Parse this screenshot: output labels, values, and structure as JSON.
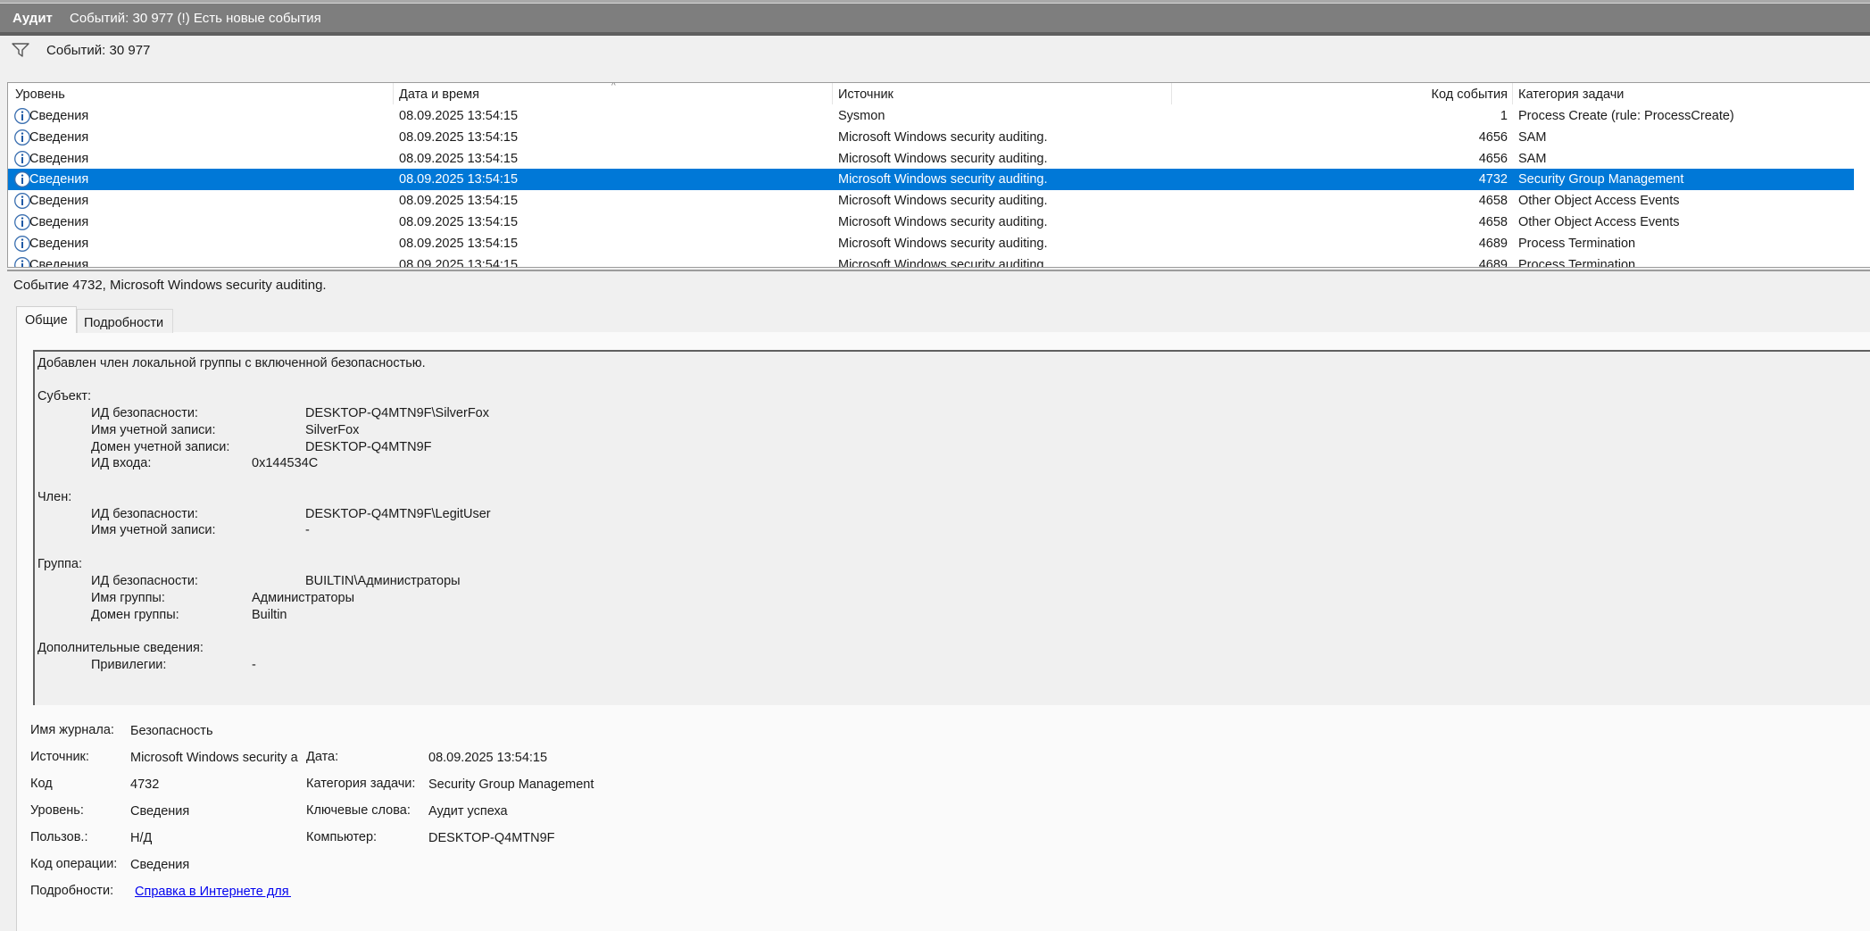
{
  "header": {
    "title": "Аудит",
    "count_text": "Событий: 30 977 (!) Есть новые события"
  },
  "filter": {
    "count_text": "Событий: 30 977"
  },
  "table": {
    "columns": [
      "Уровень",
      "Дата и время",
      "Источник",
      "Код события",
      "Категория задачи"
    ],
    "selected_row": 3,
    "rows": [
      {
        "level": "Сведения",
        "datetime": "08.09.2025 13:54:15",
        "source": "Sysmon",
        "code": "1",
        "category": "Process Create (rule: ProcessCreate)"
      },
      {
        "level": "Сведения",
        "datetime": "08.09.2025 13:54:15",
        "source": "Microsoft Windows security auditing.",
        "code": "4656",
        "category": "SAM"
      },
      {
        "level": "Сведения",
        "datetime": "08.09.2025 13:54:15",
        "source": "Microsoft Windows security auditing.",
        "code": "4656",
        "category": "SAM"
      },
      {
        "level": "Сведения",
        "datetime": "08.09.2025 13:54:15",
        "source": "Microsoft Windows security auditing.",
        "code": "4732",
        "category": "Security Group Management"
      },
      {
        "level": "Сведения",
        "datetime": "08.09.2025 13:54:15",
        "source": "Microsoft Windows security auditing.",
        "code": "4658",
        "category": "Other Object Access Events"
      },
      {
        "level": "Сведения",
        "datetime": "08.09.2025 13:54:15",
        "source": "Microsoft Windows security auditing.",
        "code": "4658",
        "category": "Other Object Access Events"
      },
      {
        "level": "Сведения",
        "datetime": "08.09.2025 13:54:15",
        "source": "Microsoft Windows security auditing.",
        "code": "4689",
        "category": "Process Termination"
      },
      {
        "level": "Сведения",
        "datetime": "08.09.2025 13:54:15",
        "source": "Microsoft Windows security auditing.",
        "code": "4689",
        "category": "Process Termination"
      }
    ]
  },
  "detail": {
    "title": "Событие 4732, Microsoft Windows security auditing.",
    "tabs": [
      "Общие",
      "Подробности"
    ],
    "message": {
      "intro": "Добавлен член локальной группы с включенной безопасностью.",
      "subject_header": "Субъект:",
      "subject": [
        {
          "label": "ИД безопасности:",
          "value": "DESKTOP-Q4MTN9F\\SilverFox"
        },
        {
          "label": "Имя учетной записи:",
          "value": "SilverFox"
        },
        {
          "label": "Домен учетной записи:",
          "value": "DESKTOP-Q4MTN9F"
        },
        {
          "label": "ИД входа:",
          "value": "0x144534C"
        }
      ],
      "member_header": "Член:",
      "member": [
        {
          "label": "ИД безопасности:",
          "value": "DESKTOP-Q4MTN9F\\LegitUser"
        },
        {
          "label": "Имя учетной записи:",
          "value": "-"
        }
      ],
      "group_header": "Группа:",
      "group": [
        {
          "label": "ИД безопасности:",
          "value": "BUILTIN\\Администраторы"
        },
        {
          "label": "Имя группы:",
          "value": "Администраторы"
        },
        {
          "label": "Домен группы:",
          "value": "Builtin"
        }
      ],
      "extra_header": "Дополнительные сведения:",
      "extra": [
        {
          "label": "Привилегии:",
          "value": "-"
        }
      ]
    },
    "fields": {
      "log_name_label": "Имя журнала:",
      "log_name": "Безопасность",
      "source_label": "Источник:",
      "source": "Microsoft Windows security auditing.",
      "date_label": "Дата:",
      "date": "08.09.2025 13:54:15",
      "code_label": "Код",
      "code": "4732",
      "category_label": "Категория задачи:",
      "category": "Security Group Management",
      "level_label": "Уровень:",
      "level": "Сведения",
      "keywords_label": "Ключевые слова:",
      "keywords": "Аудит успеха",
      "user_label": "Пользов.:",
      "user": "Н/Д",
      "computer_label": "Компьютер:",
      "computer": "DESKTOP-Q4MTN9F",
      "opcode_label": "Код операции:",
      "opcode": "Сведения",
      "more_label": "Подробности:",
      "more_link": "Справка в Интернете для журнала событий"
    }
  }
}
